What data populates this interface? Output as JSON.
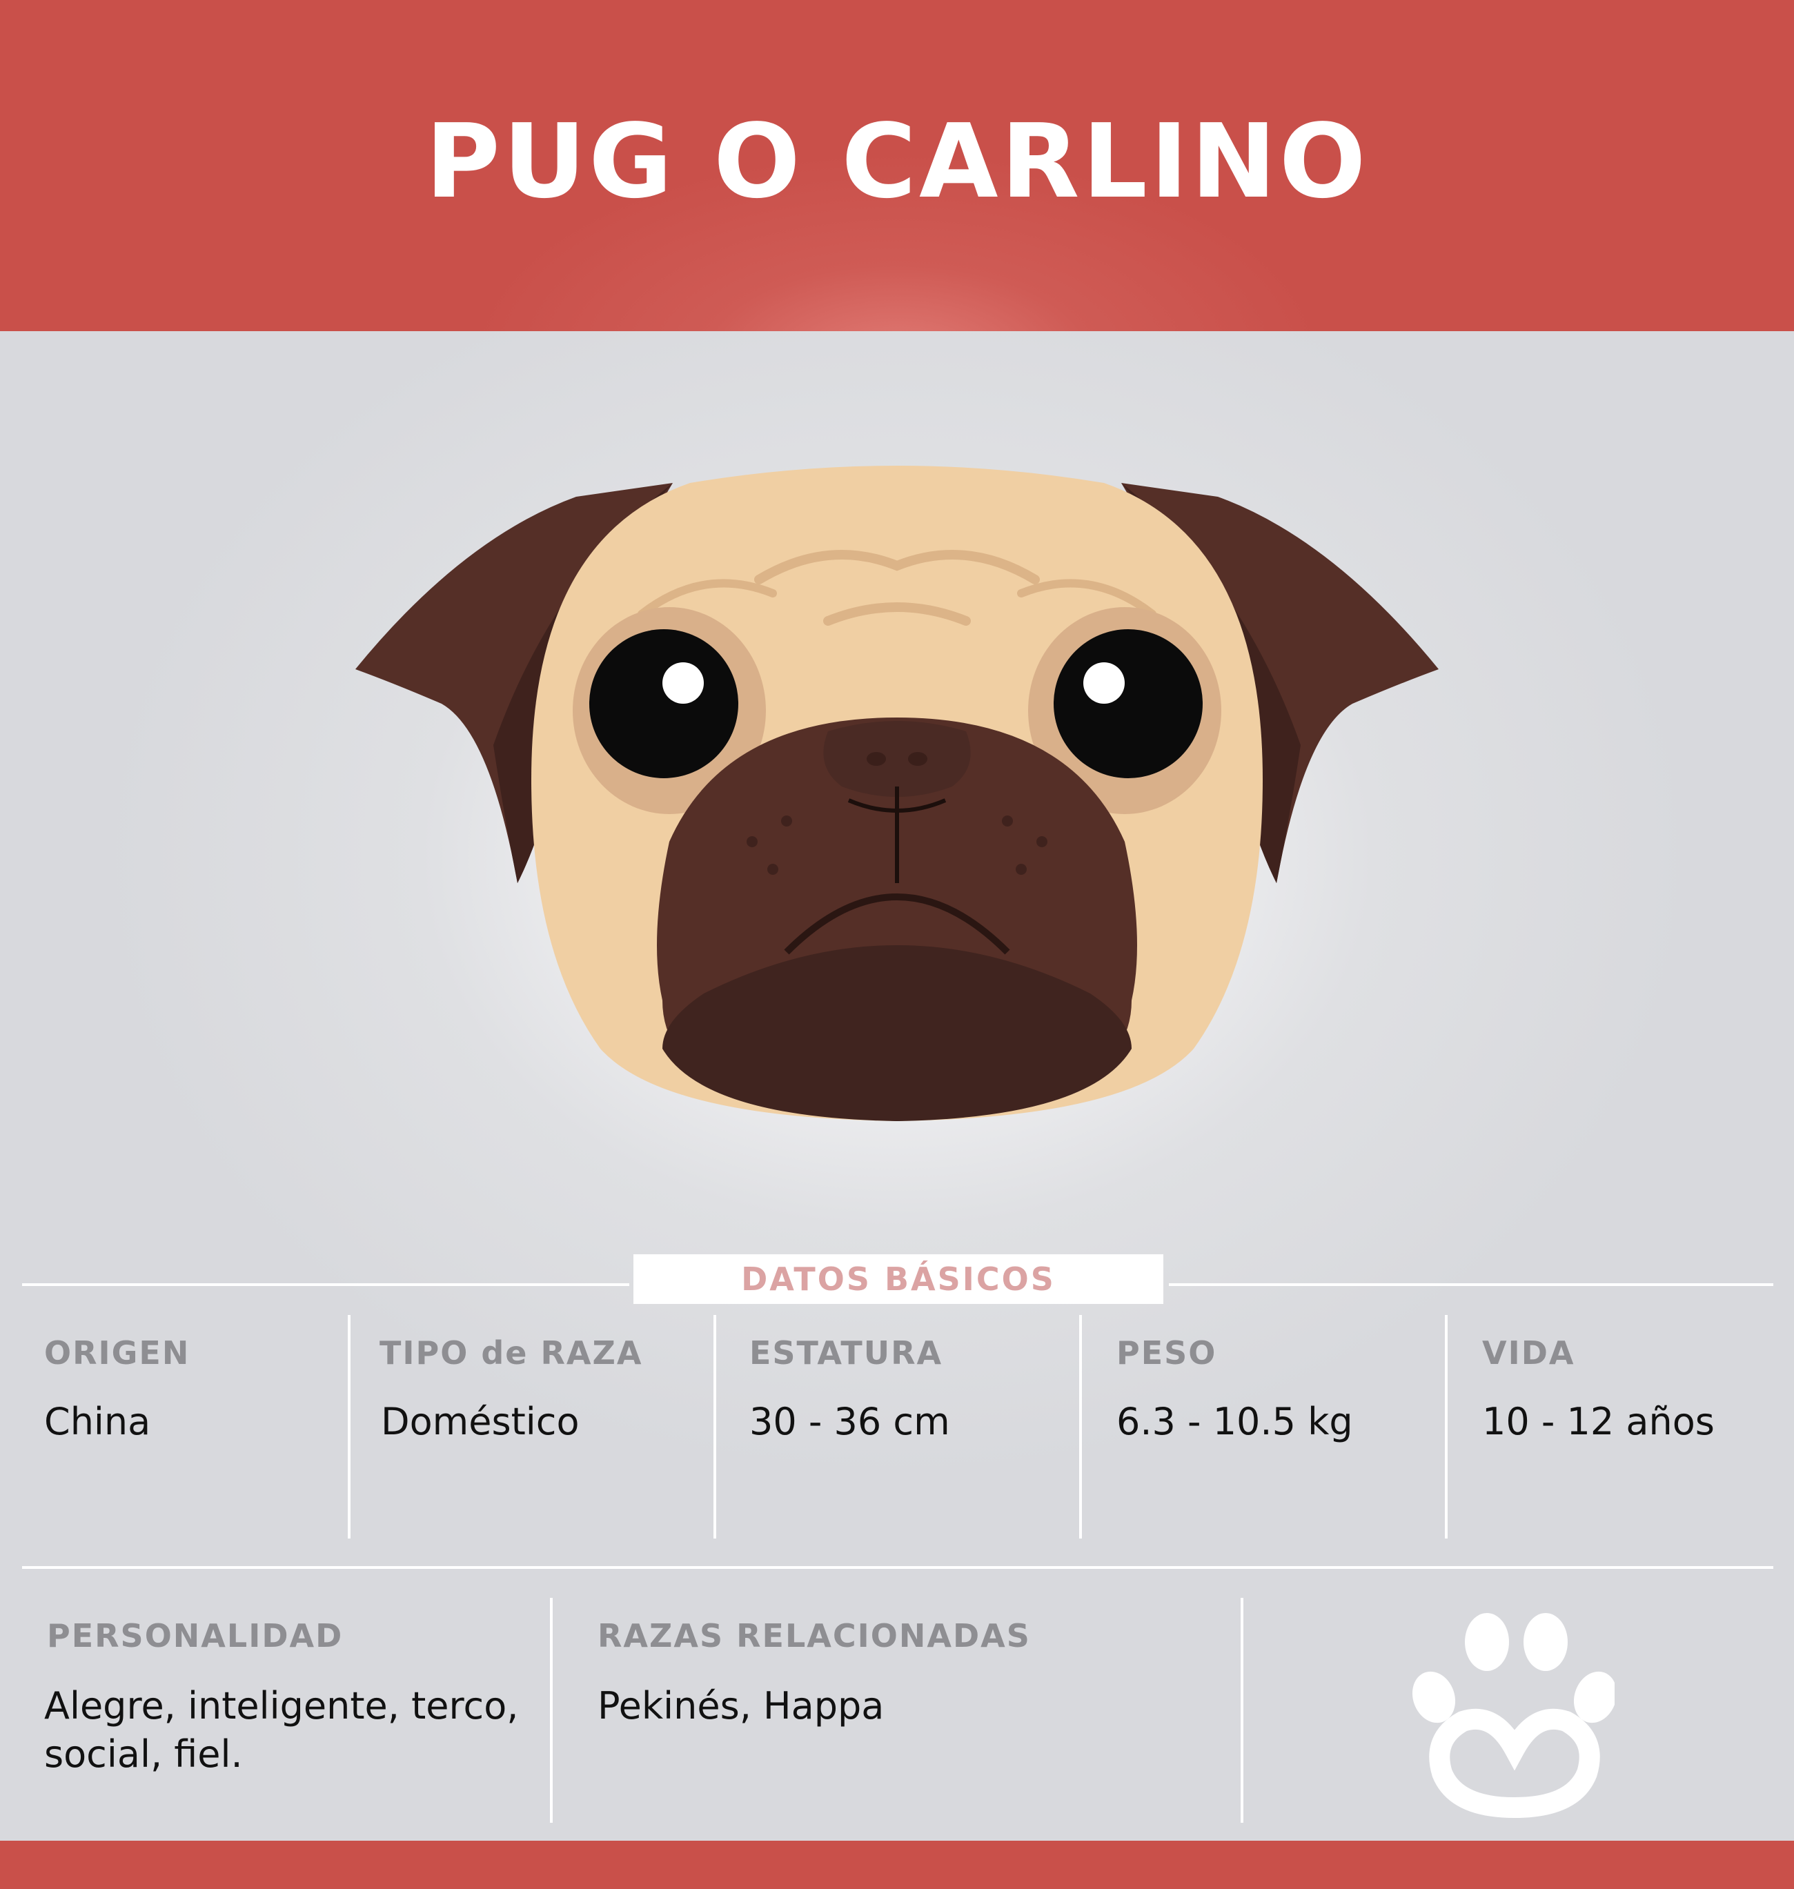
{
  "header": {
    "title": "PUG O CARLINO"
  },
  "illustration": {
    "icon": "pug-face-icon"
  },
  "basics": {
    "badge": "DATOS BÁSICOS",
    "fields": [
      {
        "label": "ORIGEN",
        "value": "China"
      },
      {
        "label": "TIPO de RAZA",
        "value": "Doméstico"
      },
      {
        "label": "ESTATURA",
        "value": "30 - 36 cm"
      },
      {
        "label": "PESO",
        "value": "6.3 - 10.5 kg"
      },
      {
        "label": "VIDA",
        "value": "10 - 12 años"
      }
    ]
  },
  "details": {
    "personality": {
      "label": "PERSONALIDAD",
      "value": "Alegre, inteligente, terco, social, fiel."
    },
    "related": {
      "label": "RAZAS RELACIONADAS",
      "value": "Pekinés, Happa"
    },
    "logo": "paw-heart-icon"
  },
  "colors": {
    "header": "#c9504a",
    "panel": "#d8d9dd",
    "badge_text": "#dba3a3",
    "label_text": "#8e8e92"
  }
}
